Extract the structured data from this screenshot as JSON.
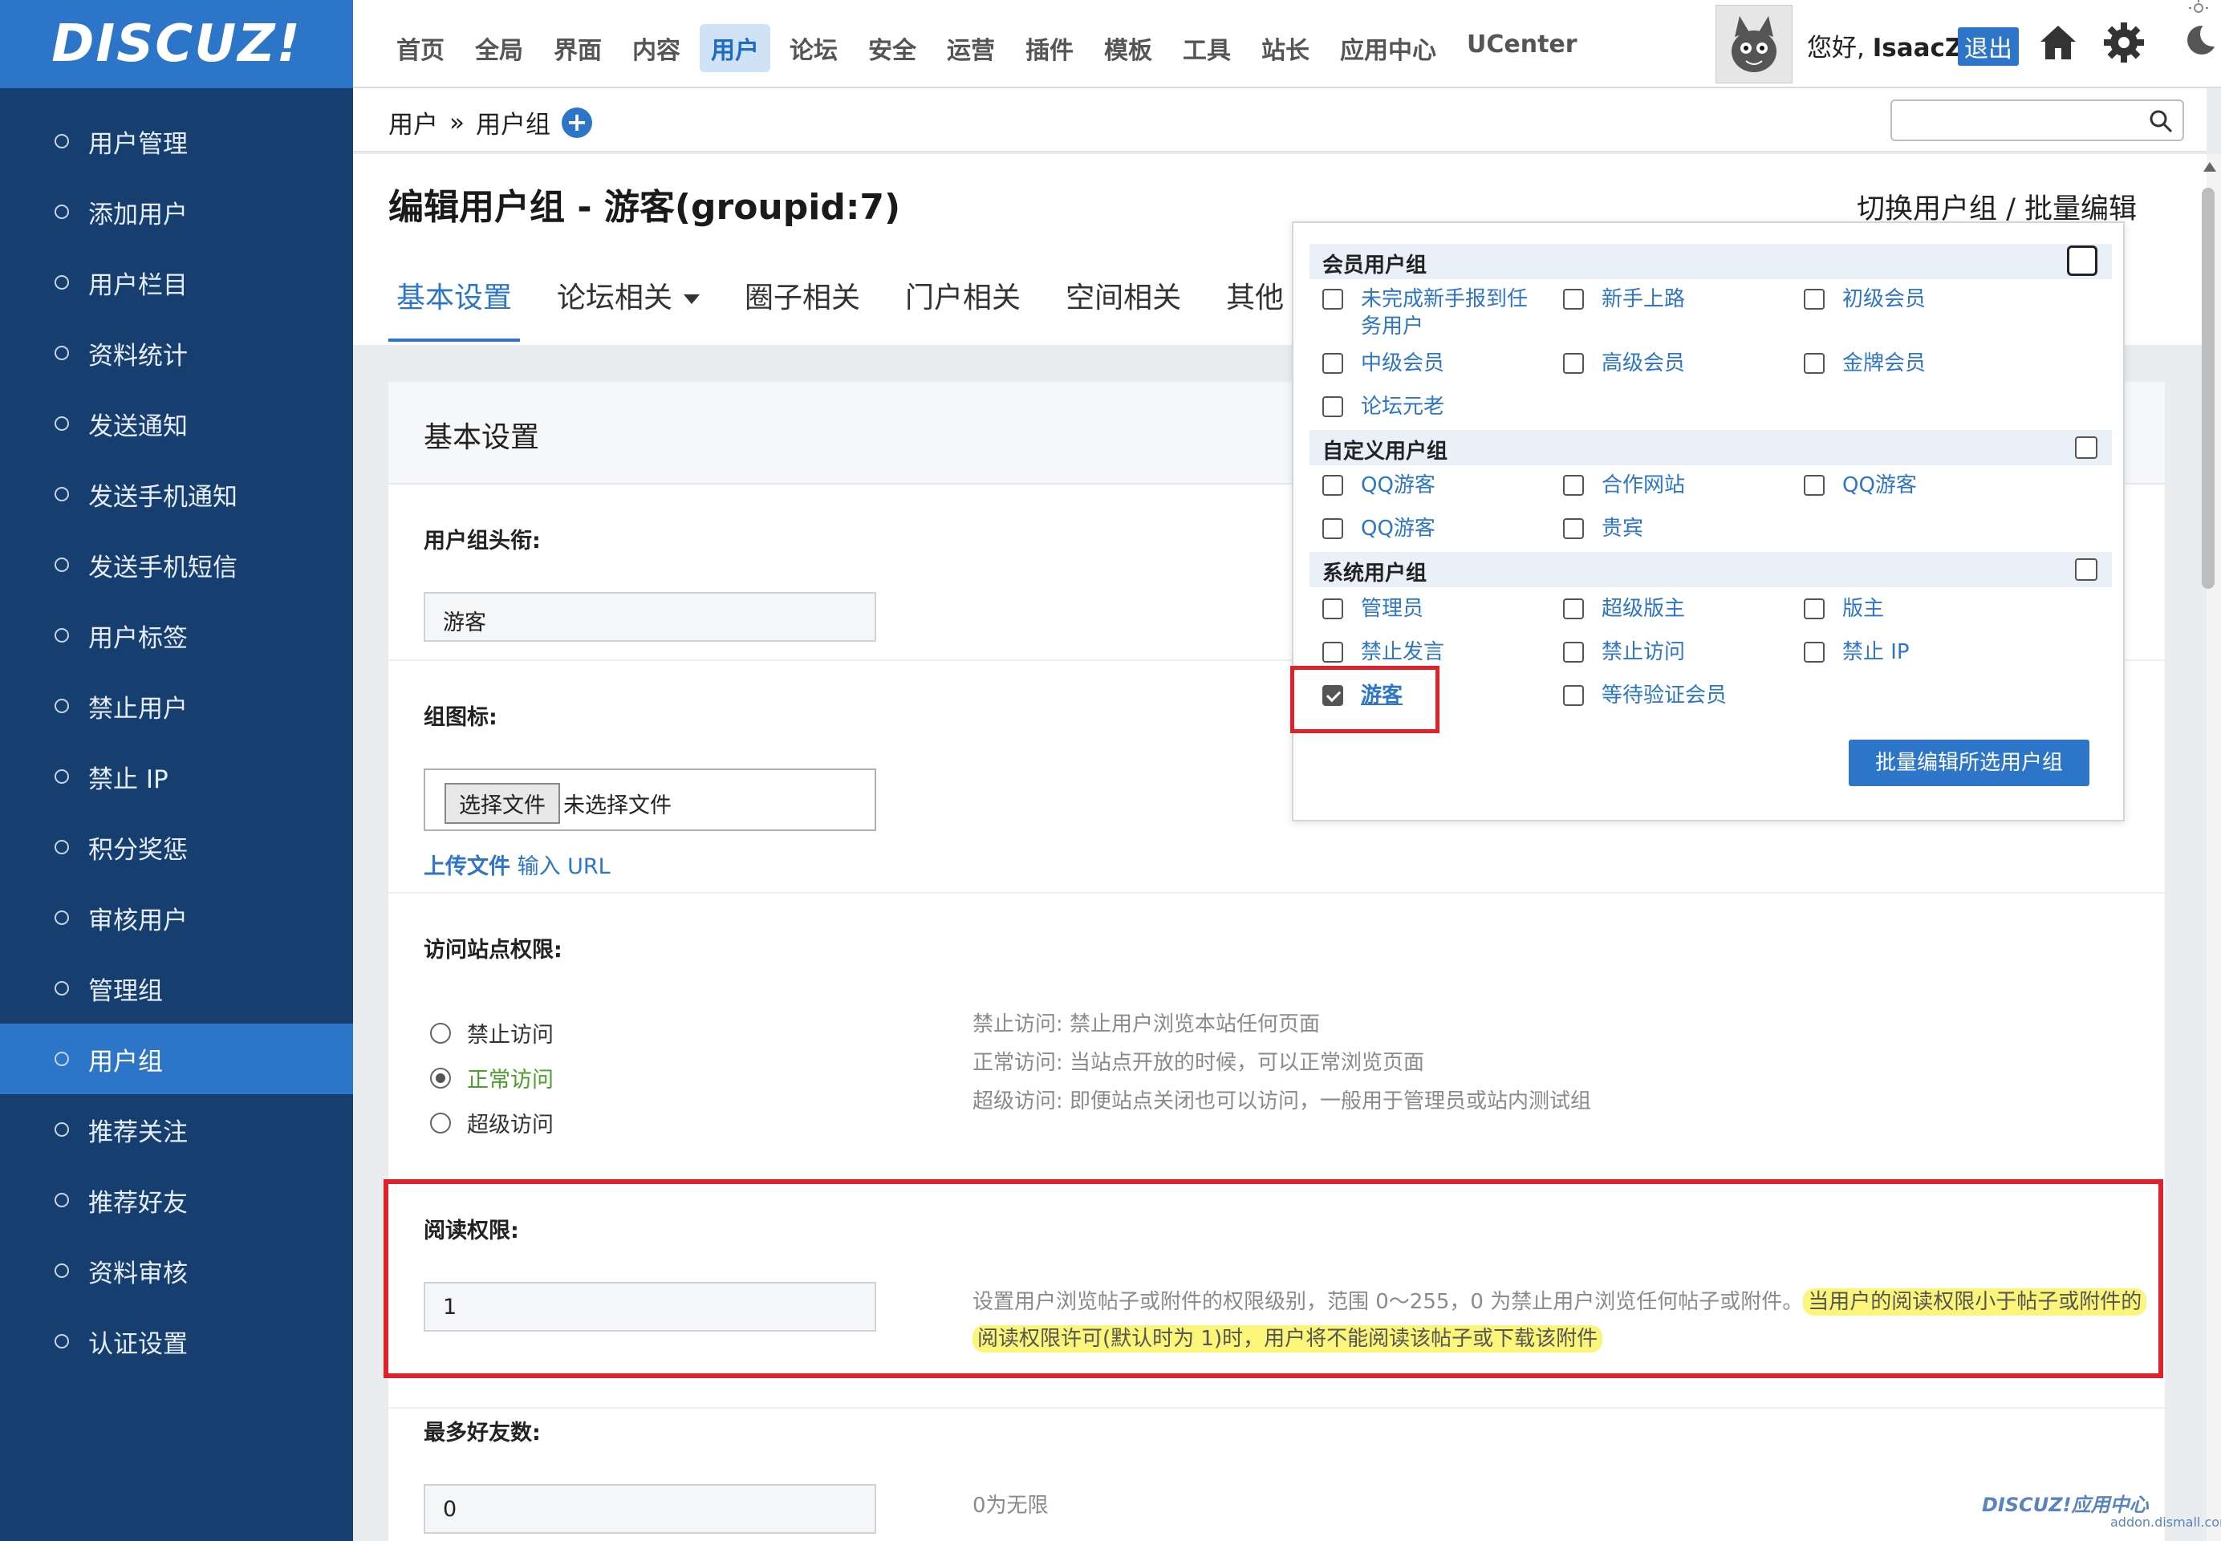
{
  "header": {
    "logo": "DISCUZ!",
    "nav": [
      "首页",
      "全局",
      "界面",
      "内容",
      "用户",
      "论坛",
      "安全",
      "运营",
      "插件",
      "模板",
      "工具",
      "站长",
      "应用中心",
      "UCenter"
    ],
    "active_nav": "用户",
    "greeting_prefix": "您好, ",
    "username": "IsaacZ",
    "logout": "退出"
  },
  "sidebar": {
    "items": [
      {
        "label": "用户管理"
      },
      {
        "label": "添加用户"
      },
      {
        "label": "用户栏目"
      },
      {
        "label": "资料统计"
      },
      {
        "label": "发送通知"
      },
      {
        "label": "发送手机通知"
      },
      {
        "label": "发送手机短信"
      },
      {
        "label": "用户标签"
      },
      {
        "label": "禁止用户"
      },
      {
        "label": "禁止 IP"
      },
      {
        "label": "积分奖惩"
      },
      {
        "label": "审核用户"
      },
      {
        "label": "管理组"
      },
      {
        "label": "用户组"
      },
      {
        "label": "推荐关注"
      },
      {
        "label": "推荐好友"
      },
      {
        "label": "资料审核"
      },
      {
        "label": "认证设置"
      }
    ],
    "active": "用户组"
  },
  "breadcrumb": {
    "part1": "用户",
    "sep": "»",
    "part2": "用户组",
    "add": "+"
  },
  "main": {
    "title": "编辑用户组 - 游客(groupid:7)",
    "switch": "切换用户组 / 批量编辑",
    "tabs": [
      "基本设置",
      "论坛相关",
      "圈子相关",
      "门户相关",
      "空间相关",
      "其他"
    ],
    "active_tab": "基本设置"
  },
  "form": {
    "panel_title": "基本设置",
    "title_label": "用户组头衔:",
    "title_value": "游客",
    "icon_label": "组图标:",
    "file_button": "选择文件",
    "file_none": "未选择文件",
    "upload": "上传文件",
    "input_url": " 输入 URL",
    "access_label": "访问站点权限:",
    "access_options": [
      "禁止访问",
      "正常访问",
      "超级访问"
    ],
    "access_selected": "正常访问",
    "access_help": [
      "禁止访问: 禁止用户浏览本站任何页面",
      "正常访问: 当站点开放的时候，可以正常浏览页面",
      "超级访问: 即便站点关闭也可以访问，一般用于管理员或站内测试组"
    ],
    "read_label": "阅读权限:",
    "read_value": "1",
    "read_help_plain": "设置用户浏览帖子或附件的权限级别，范围 0～255，0 为禁止用户浏览任何帖子或附件。",
    "read_help_hl1": "当用户的阅读权限小于帖子或附件的",
    "read_help_hl2": "阅读权限许可(默认时为 1)时，用户将不能阅读该帖子或下载该附件",
    "friends_label": "最多好友数:",
    "friends_value": "0",
    "friends_help": "0为无限"
  },
  "dropdown": {
    "member_head": "会员用户组",
    "member": [
      "未完成新手报到任务用户",
      "新手上路",
      "初级会员",
      "中级会员",
      "高级会员",
      "金牌会员",
      "论坛元老"
    ],
    "custom_head": "自定义用户组",
    "custom": [
      "QQ游客",
      "合作网站",
      "QQ游客",
      "QQ游客",
      "贵宾"
    ],
    "system_head": "系统用户组",
    "system": [
      "管理员",
      "超级版主",
      "版主",
      "禁止发言",
      "禁止访问",
      "禁止 IP",
      "游客",
      "等待验证会员"
    ],
    "checked": "游客",
    "batch_button": "批量编辑所选用户组"
  },
  "watermark": {
    "brand": "DISCUZ!应用中心",
    "url": "addon.dismall.com"
  },
  "colors": {
    "brand_blue": "#2d75c9",
    "sidebar": "#163f6f",
    "highlight": "#fbf57a",
    "annotation_red": "#e0202a"
  }
}
